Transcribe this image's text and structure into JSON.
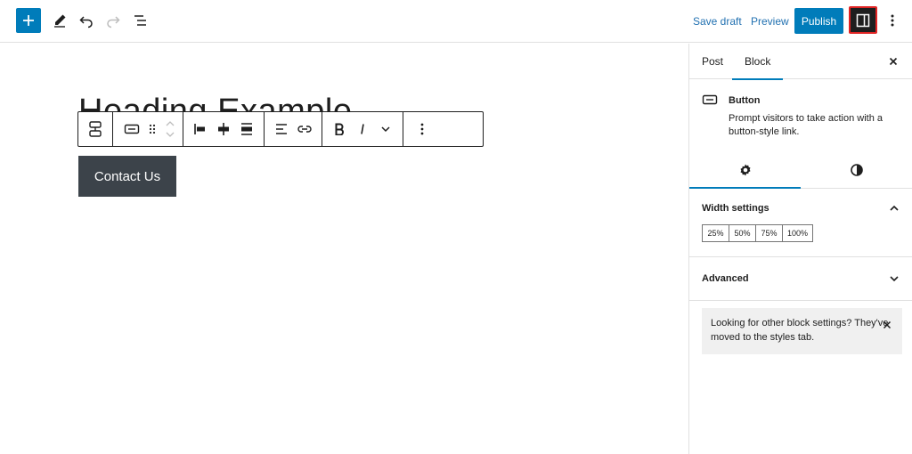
{
  "toolbar": {
    "add_icon": "plus-icon",
    "tools_icon": "pencil-icon",
    "undo_icon": "undo-icon",
    "redo_icon": "redo-icon",
    "list_view_icon": "list-view-icon",
    "save_draft": "Save draft",
    "preview": "Preview",
    "publish": "Publish",
    "settings_icon": "sidebar-toggle-icon",
    "options_icon": "more-vertical-icon",
    "accent": "#007cba"
  },
  "canvas": {
    "heading": "Heading Example",
    "button_text": "Contact Us",
    "button_color": "#3c434a"
  },
  "block_toolbar": {
    "items": [
      "transform-icon",
      "button-block-icon",
      "drag-handle-icon",
      "move-up-icon",
      "move-down-icon",
      "justify-left-icon",
      "justify-center-icon",
      "justify-stretch-icon",
      "align-icon",
      "link-icon",
      "bold-icon",
      "italic-icon",
      "more-options-chevron-icon",
      "block-options-icon"
    ]
  },
  "sidebar": {
    "tabs": [
      "Post",
      "Block"
    ],
    "active_tab": "Block",
    "block": {
      "title": "Button",
      "description": "Prompt visitors to take action with a button-style link."
    },
    "inner_tabs": [
      "settings-gear-icon",
      "styles-contrast-icon"
    ],
    "width_settings": {
      "title": "Width settings",
      "options": [
        "25%",
        "50%",
        "75%",
        "100%"
      ]
    },
    "advanced": {
      "title": "Advanced"
    },
    "notice": {
      "text": "Looking for other block settings? They've moved to the styles tab."
    }
  }
}
